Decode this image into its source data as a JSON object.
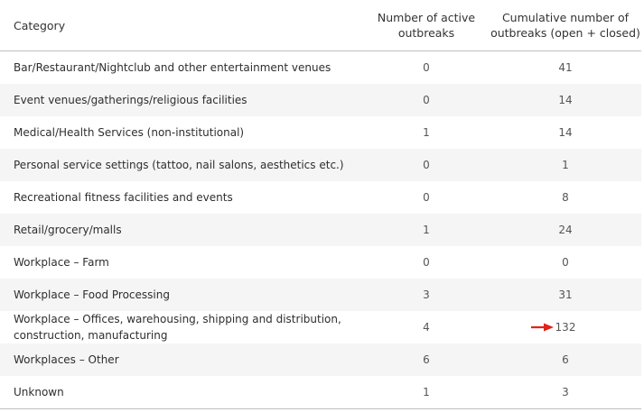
{
  "table": {
    "headers": {
      "category": "Category",
      "active": "Number of active outbreaks",
      "cumulative": "Cumulative number of outbreaks (open + closed)"
    },
    "rows": [
      {
        "category": "Bar/Restaurant/Nightclub and other entertainment venues",
        "active": "0",
        "cumulative": "41"
      },
      {
        "category": "Event venues/gatherings/religious facilities",
        "active": "0",
        "cumulative": "14"
      },
      {
        "category": "Medical/Health Services (non-institutional)",
        "active": "1",
        "cumulative": "14"
      },
      {
        "category": "Personal service settings (tattoo, nail salons, aesthetics etc.)",
        "active": "0",
        "cumulative": "1"
      },
      {
        "category": "Recreational fitness facilities and events",
        "active": "0",
        "cumulative": "8"
      },
      {
        "category": "Retail/grocery/malls",
        "active": "1",
        "cumulative": "24"
      },
      {
        "category": "Workplace – Farm",
        "active": "0",
        "cumulative": "0"
      },
      {
        "category": "Workplace – Food Processing",
        "active": "3",
        "cumulative": "31"
      },
      {
        "category": "Workplace – Offices, warehousing, shipping and distribution, construction, manufacturing",
        "active": "4",
        "cumulative": "132"
      },
      {
        "category": "Workplaces – Other",
        "active": "6",
        "cumulative": "6"
      },
      {
        "category": "Unknown",
        "active": "1",
        "cumulative": "3"
      }
    ]
  },
  "annotation": {
    "icon": "arrow-right-icon",
    "color": "#e0231b"
  },
  "colors": {
    "stripe": "#f5f5f5",
    "rule": "#bfbfbf",
    "text": "#2e2e2e"
  }
}
